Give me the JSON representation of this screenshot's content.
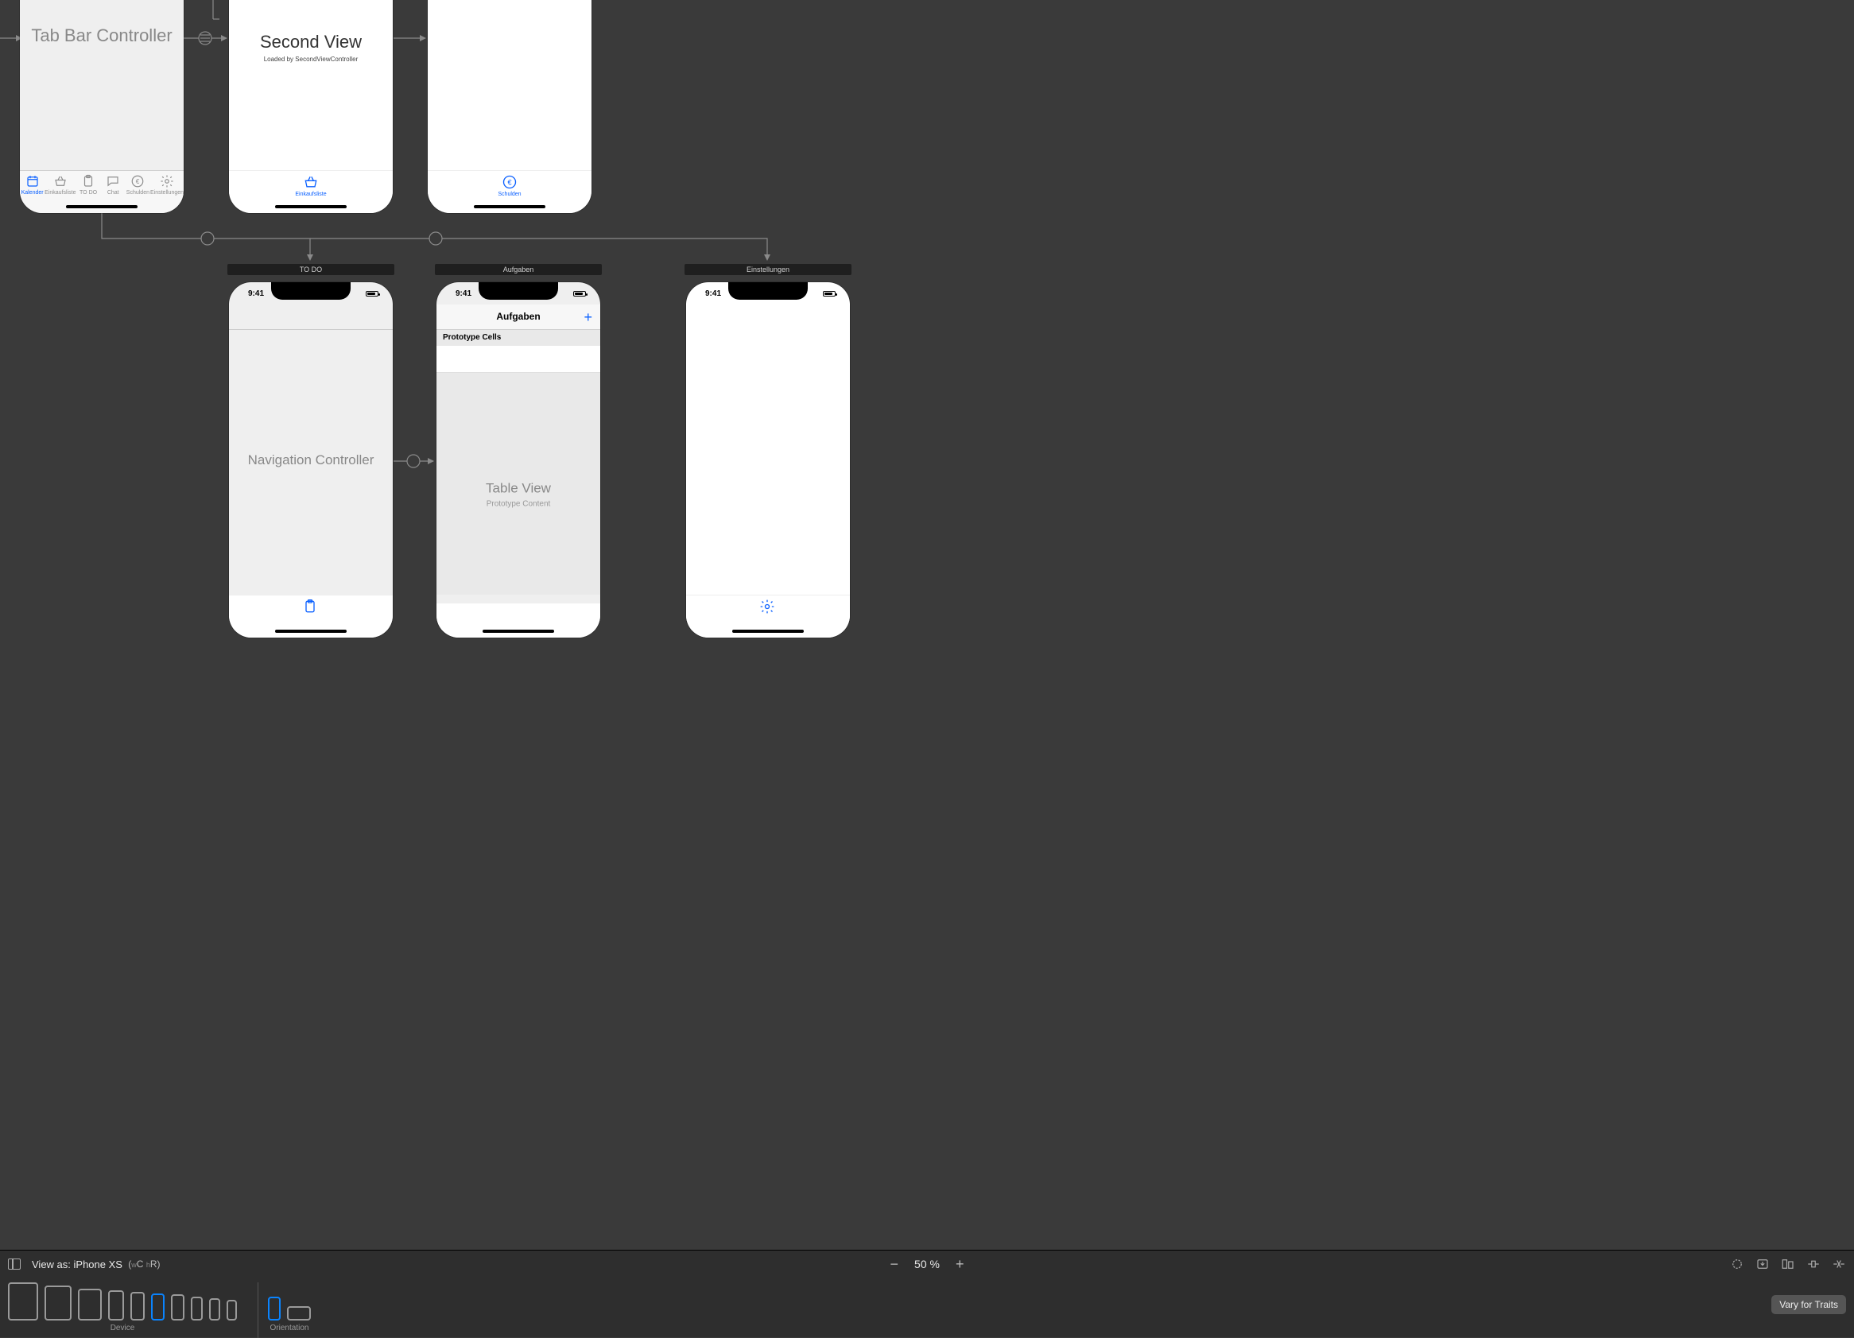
{
  "scenes": {
    "tabbar_controller": {
      "title": "Tab Bar Controller",
      "tabs": [
        {
          "label": "Kalender",
          "icon": "calendar",
          "active": true
        },
        {
          "label": "Einkaufsliste",
          "icon": "basket",
          "active": false
        },
        {
          "label": "TO DO",
          "icon": "clipboard",
          "active": false
        },
        {
          "label": "Chat",
          "icon": "chat",
          "active": false
        },
        {
          "label": "Schulden",
          "icon": "euro",
          "active": false
        },
        {
          "label": "Einstellungen",
          "icon": "gear",
          "active": false
        }
      ]
    },
    "second_view": {
      "title": "Second View",
      "subtitle": "Loaded by SecondViewController",
      "tab": {
        "label": "Einkaufsliste",
        "icon": "basket"
      }
    },
    "schulden_view": {
      "tab": {
        "label": "Schulden",
        "icon": "euro"
      }
    },
    "nav_controller": {
      "scene_title": "TO DO",
      "status_time": "9:41",
      "title": "Navigation Controller",
      "tab_icon": "clipboard"
    },
    "aufgaben": {
      "scene_title": "Aufgaben",
      "status_time": "9:41",
      "nav_title": "Aufgaben",
      "proto_header": "Prototype Cells",
      "body_title": "Table View",
      "body_sub": "Prototype Content",
      "add_glyph": "+"
    },
    "einstellungen": {
      "scene_title": "Einstellungen",
      "status_time": "9:41",
      "tab_icon": "gear"
    }
  },
  "toolbar": {
    "view_as_prefix": "View as: ",
    "view_as_device": "iPhone XS",
    "traits_w": "w",
    "traits_C": "C",
    "traits_h": "h",
    "traits_R": "R",
    "traits_open": "(",
    "traits_close": ")",
    "zoom": "50 %",
    "minus": "−",
    "plus": "+",
    "device_label": "Device",
    "orientation_label": "Orientation",
    "vary_label": "Vary for Traits"
  },
  "devices": [
    {
      "w": 38,
      "h": 48,
      "sel": false
    },
    {
      "w": 34,
      "h": 44,
      "sel": false
    },
    {
      "w": 30,
      "h": 40,
      "sel": false
    },
    {
      "w": 20,
      "h": 38,
      "sel": false
    },
    {
      "w": 18,
      "h": 36,
      "sel": false
    },
    {
      "w": 17,
      "h": 34,
      "sel": true
    },
    {
      "w": 17,
      "h": 33,
      "sel": false
    },
    {
      "w": 15,
      "h": 30,
      "sel": false
    },
    {
      "w": 14,
      "h": 28,
      "sel": false
    },
    {
      "w": 13,
      "h": 26,
      "sel": false
    }
  ],
  "orientations": [
    {
      "w": 16,
      "h": 30,
      "sel": true
    },
    {
      "w": 30,
      "h": 18,
      "sel": false
    }
  ]
}
